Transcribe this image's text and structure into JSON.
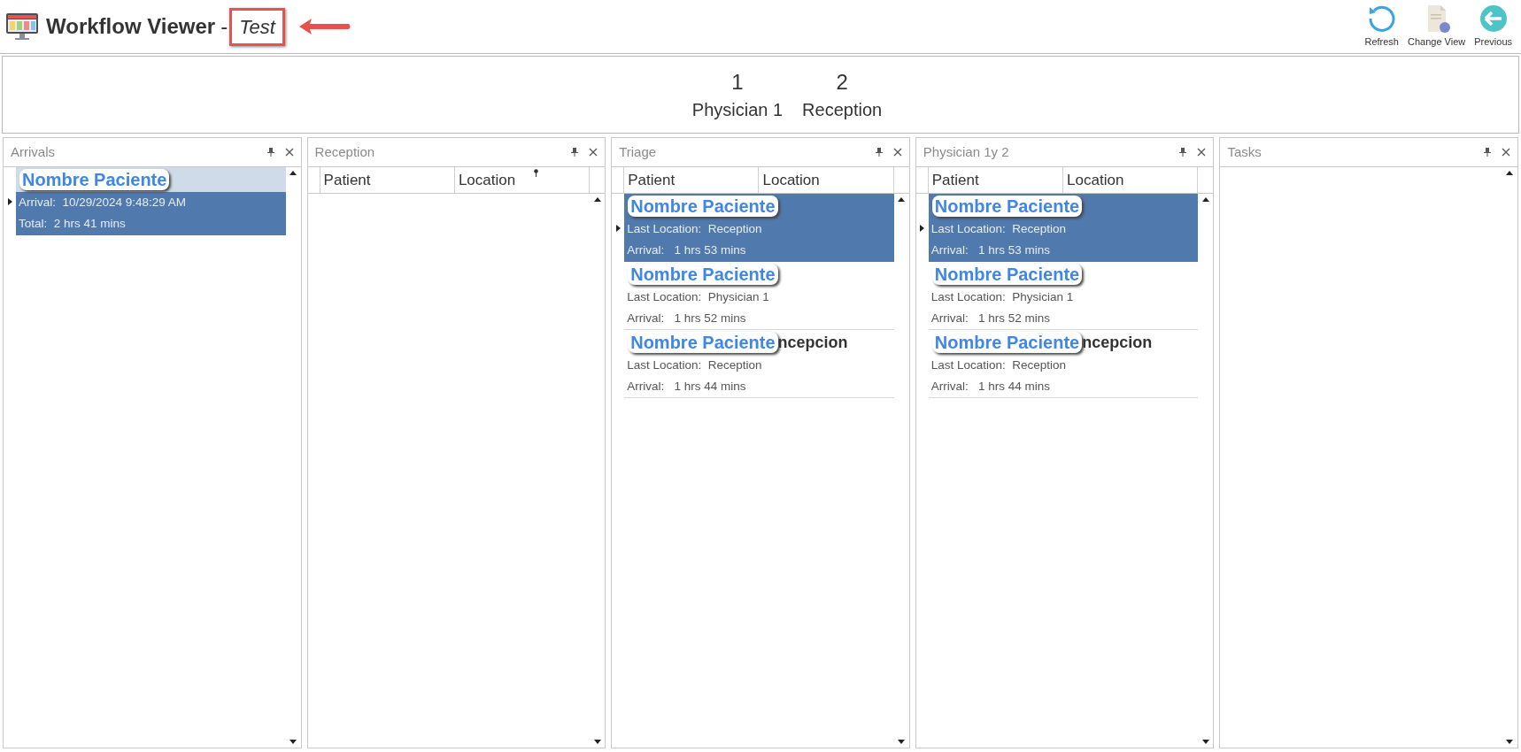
{
  "window": {
    "title": "Workflow Viewer",
    "separator": "-",
    "subtitle": "Test",
    "subtitle_highlighted": true
  },
  "toolbar": [
    {
      "label": "Refresh",
      "kind": "refresh"
    },
    {
      "label": "Change View",
      "kind": "change_view"
    },
    {
      "label": "Previous",
      "kind": "previous"
    }
  ],
  "summary": [
    {
      "count": "1",
      "label": "Physician 1"
    },
    {
      "count": "2",
      "label": "Reception"
    }
  ],
  "panels": [
    {
      "title": "Arrivals",
      "kind": "cards",
      "rows": [
        {
          "name": "Nombre Paciente",
          "lines": [
            "Arrival:  10/29/2024 9:48:29 AM",
            "Total:  2 hrs 41 mins"
          ],
          "selected": true
        }
      ]
    },
    {
      "title": "Reception",
      "kind": "grid",
      "columns": [
        {
          "label": "Patient",
          "filtered": false
        },
        {
          "label": "Location",
          "filtered": true
        }
      ]
    },
    {
      "title": "Triage",
      "kind": "grid",
      "columns": [
        {
          "label": "Patient",
          "filtered": false
        },
        {
          "label": "Location",
          "filtered": false
        }
      ],
      "rows": [
        {
          "name": "Nombre Paciente",
          "lines": [
            "Last Location:  Reception",
            "Arrival:   1 hrs 53 mins"
          ],
          "selected": true
        },
        {
          "name": "Nombre Paciente",
          "lines": [
            "Last Location:  Physician 1",
            "Arrival:   1 hrs 52 mins"
          ],
          "selected": false
        },
        {
          "name": "Nombre Paciente",
          "tail": "ncepcion",
          "lines": [
            "Last Location:  Reception",
            "Arrival:   1 hrs 44 mins"
          ],
          "selected": false
        }
      ]
    },
    {
      "title": "Physician 1y 2",
      "kind": "grid",
      "columns": [
        {
          "label": "Patient",
          "filtered": false
        },
        {
          "label": "Location",
          "filtered": false
        }
      ],
      "rows": [
        {
          "name": "Nombre Paciente",
          "lines": [
            "Last Location:  Reception",
            "Arrival:   1 hrs 53 mins"
          ],
          "selected": true
        },
        {
          "name": "Nombre Paciente",
          "lines": [
            "Last Location:  Physician 1",
            "Arrival:   1 hrs 52 mins"
          ],
          "selected": false
        },
        {
          "name": "Nombre Paciente",
          "tail": "ncepcion",
          "lines": [
            "Last Location:  Reception",
            "Arrival:   1 hrs 44 mins"
          ],
          "selected": false
        }
      ]
    },
    {
      "title": "Tasks",
      "kind": "list"
    }
  ]
}
